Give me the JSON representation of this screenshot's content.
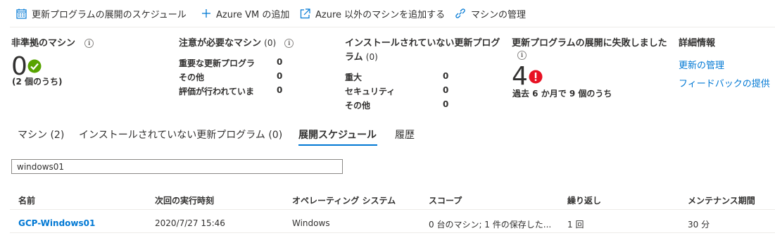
{
  "toolbar": {
    "schedule_label": "更新プログラムの展開のスケジュール",
    "add_azure_vm_label": "Azure VM の追加",
    "add_non_azure_label": "Azure 以外のマシンを追加する",
    "manage_machines_label": "マシンの管理"
  },
  "summary": {
    "noncompliant": {
      "title": "非準拠のマシン",
      "info": "i",
      "value": "0",
      "sub": "(2 個のうち)"
    },
    "attention": {
      "title": "注意が必要なマシン",
      "count": "(0)",
      "info": "i",
      "rows": [
        {
          "label": "重要な更新プログラ",
          "value": "0"
        },
        {
          "label": "その他",
          "value": "0"
        },
        {
          "label": "評価が行われていま",
          "value": "0"
        }
      ]
    },
    "missing": {
      "title_line1": "インストールされていない更新プログ",
      "title_line2": "ラム",
      "count": "(0)",
      "rows": [
        {
          "label": "重大",
          "value": "0"
        },
        {
          "label": "セキュリティ",
          "value": "0"
        },
        {
          "label": "その他",
          "value": "0"
        }
      ]
    },
    "failed": {
      "title": "更新プログラムの展開に失敗しました",
      "info": "i",
      "value": "4",
      "sub": "過去 6 か月で 9 個のうち"
    },
    "details": {
      "title": "詳細情報",
      "link1": "更新の管理",
      "link2": "フィードバックの提供"
    }
  },
  "tabs": {
    "machines": "マシン (2)",
    "missing_updates": "インストールされていない更新プログラム (0)",
    "deployment_schedule": "展開スケジュール",
    "history": "履歴"
  },
  "search": {
    "value": "windows01"
  },
  "table": {
    "headers": {
      "name": "名前",
      "next_run": "次回の実行時刻",
      "os": "オペレーティング システム",
      "scope": "スコープ",
      "recurrence": "繰り返し",
      "window": "メンテナンス期間"
    },
    "rows": [
      {
        "name": "GCP-Windows01",
        "next_run": "2020/7/27 15:46",
        "os": "Windows",
        "scope": "0 台のマシン; 1 件の保存した...",
        "recurrence": "1 回",
        "window": "30 分"
      }
    ]
  },
  "colors": {
    "accent": "#0078d4",
    "success": "#57a300",
    "error": "#e81123"
  }
}
